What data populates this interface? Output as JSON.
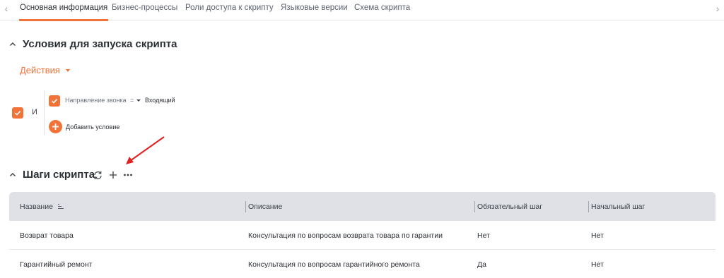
{
  "tabs": [
    {
      "label": "Основная информация",
      "active": true
    },
    {
      "label": "Бизнес-процессы",
      "active": false
    },
    {
      "label": "Роли доступа к скрипту",
      "active": false
    },
    {
      "label": "Языковые версии",
      "active": false
    },
    {
      "label": "Схема скрипта",
      "active": false
    }
  ],
  "conditions_section": {
    "title": "Условия для запуска скрипта",
    "actions_label": "Действия",
    "group_operator": "И",
    "condition": {
      "field": "Направление звонка",
      "operator": "=",
      "value": "Входящий"
    },
    "add_condition_label": "Добавить условие"
  },
  "steps_section": {
    "title": "Шаги скрипта",
    "columns": [
      "Название",
      "Описание",
      "Обязательный шаг",
      "Начальный шаг"
    ],
    "rows": [
      {
        "name": "Возврат товара",
        "description": "Консультация по вопросам возврата товара по гарантии",
        "required": "Нет",
        "initial": "Нет"
      },
      {
        "name": "Гарантийный ремонт",
        "description": "Консультация по вопросам гарантийного ремонта",
        "required": "Да",
        "initial": "Нет"
      }
    ]
  },
  "icons": {
    "tab_prev": "chevron-left-icon",
    "tab_next": "chevron-right-icon",
    "collapse": "chevron-up-icon",
    "refresh": "refresh-icon",
    "add": "plus-icon",
    "more": "more-dots-icon",
    "sort": "sort-icon",
    "annotation": "red-arrow-icon"
  },
  "colors": {
    "accent": "#f2733a",
    "table_header_bg": "#dfe1e6",
    "annotation": "#e02020"
  }
}
